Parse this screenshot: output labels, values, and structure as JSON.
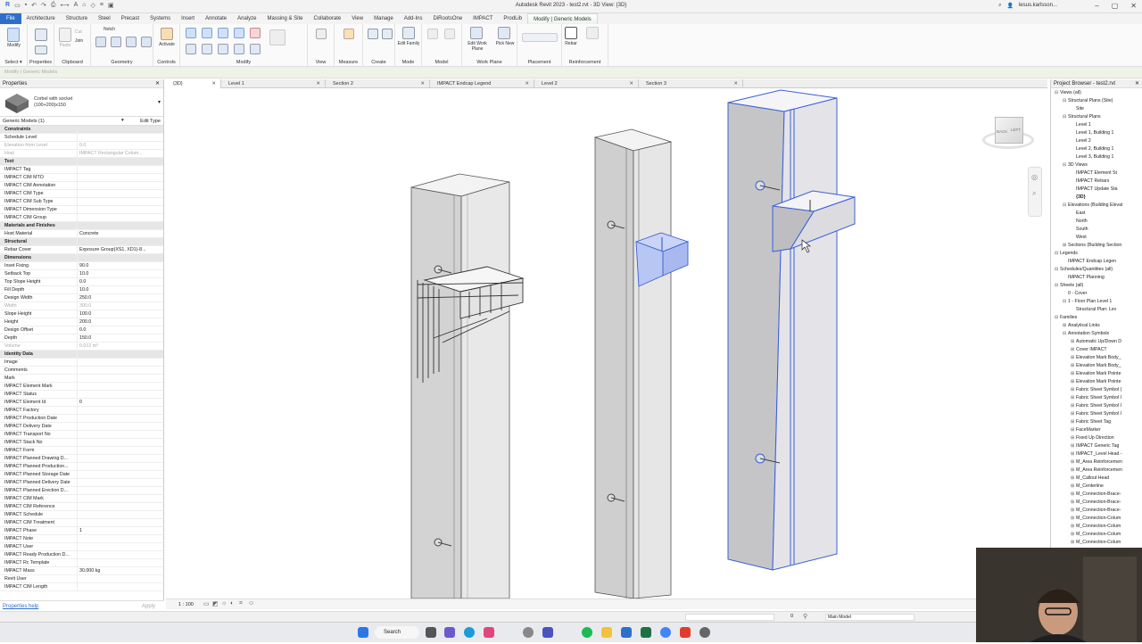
{
  "window": {
    "title": "Autodesk Revit 2023 - test2.rvt - 3D View: {3D}",
    "user": "lesus.karlsson..."
  },
  "tabs": [
    "File",
    "Architecture",
    "Structure",
    "Steel",
    "Precast",
    "Systems",
    "Insert",
    "Annotate",
    "Analyze",
    "Massing & Site",
    "Collaborate",
    "View",
    "Manage",
    "Add-Ins",
    "DiRootsOne",
    "IMPACT",
    "ProdLib",
    "Modify | Generic Models"
  ],
  "ribbon": {
    "groups": [
      "Select",
      "Properties",
      "Clipboard",
      "Geometry",
      "Modify",
      "View",
      "Measure",
      "Create",
      "Mode",
      "Model",
      "Work Plane",
      "Placement",
      "Reinforcement"
    ],
    "select_dropdown": "Select ▾",
    "buttons": {
      "modify": "Modify",
      "paste": "Paste",
      "cut": "Cut",
      "join": "Join",
      "notch": "Notch",
      "activate": "Activate",
      "edit_family": "Edit Family",
      "rebar": "Rebar",
      "edit_work_plane": "Edit Work Plane",
      "pick_new": "Pick New"
    }
  },
  "optionsbar": {
    "text": "Modify | Generic Models"
  },
  "properties": {
    "title": "Properties",
    "type_name": "Corbel with socket (100+200)x150",
    "selector": "Generic Models (1)",
    "edit_type": "Edit Type",
    "rows": [
      {
        "k": "Constraints",
        "v": "",
        "cat": true
      },
      {
        "k": "Schedule Level",
        "v": ""
      },
      {
        "k": "Elevation from Level",
        "v": "0.0",
        "dim": true
      },
      {
        "k": "Host",
        "v": "IMPACT Rectangular Colum...",
        "dim": true
      },
      {
        "k": "Text",
        "v": "",
        "cat": true
      },
      {
        "k": "IMPACT Tag",
        "v": ""
      },
      {
        "k": "IMPACT CIM MTO",
        "v": ""
      },
      {
        "k": "IMPACT CIM Annotation",
        "v": ""
      },
      {
        "k": "IMPACT CIM Type",
        "v": ""
      },
      {
        "k": "IMPACT CIM Sub Type",
        "v": ""
      },
      {
        "k": "IMPACT Dimension Type",
        "v": ""
      },
      {
        "k": "IMPACT CIM Group",
        "v": ""
      },
      {
        "k": "Materials and Finishes",
        "v": "",
        "cat": true
      },
      {
        "k": "Host Material",
        "v": "Concrete"
      },
      {
        "k": "Structural",
        "v": "",
        "cat": true
      },
      {
        "k": "Rebar Cover",
        "v": "Exposure Group(XS1, XD1)-8..."
      },
      {
        "k": "Dimensions",
        "v": "",
        "cat": true
      },
      {
        "k": "Inset Fixing",
        "v": "90.0"
      },
      {
        "k": "Setback Top",
        "v": "10.0"
      },
      {
        "k": "Top Slope Height",
        "v": "0.0"
      },
      {
        "k": "Fill Depth",
        "v": "10.0"
      },
      {
        "k": "Design Width",
        "v": "250.0"
      },
      {
        "k": "Width",
        "v": "300.0",
        "dim": true
      },
      {
        "k": "Slope Height",
        "v": "100.0"
      },
      {
        "k": "Height",
        "v": "200.0"
      },
      {
        "k": "Design Offset",
        "v": "0.0"
      },
      {
        "k": "Depth",
        "v": "150.0"
      },
      {
        "k": "Volume",
        "v": "0.012 m³",
        "dim": true
      },
      {
        "k": "Identity Data",
        "v": "",
        "cat": true
      },
      {
        "k": "Image",
        "v": ""
      },
      {
        "k": "Comments",
        "v": ""
      },
      {
        "k": "Mark",
        "v": ""
      },
      {
        "k": "IMPACT Element Mark",
        "v": ""
      },
      {
        "k": "IMPACT Status",
        "v": ""
      },
      {
        "k": "IMPACT Element Id",
        "v": "0"
      },
      {
        "k": "IMPACT Factory",
        "v": ""
      },
      {
        "k": "IMPACT Production Date",
        "v": ""
      },
      {
        "k": "IMPACT Delivery Date",
        "v": ""
      },
      {
        "k": "IMPACT Transport No",
        "v": ""
      },
      {
        "k": "IMPACT Stack No",
        "v": ""
      },
      {
        "k": "IMPACT Form",
        "v": ""
      },
      {
        "k": "IMPACT Planned Drawing D...",
        "v": ""
      },
      {
        "k": "IMPACT Planned Production...",
        "v": ""
      },
      {
        "k": "IMPACT Planned Storage Date",
        "v": ""
      },
      {
        "k": "IMPACT Planned Delivery Date",
        "v": ""
      },
      {
        "k": "IMPACT Planned Erection D...",
        "v": ""
      },
      {
        "k": "IMPACT CIM Mark",
        "v": ""
      },
      {
        "k": "IMPACT CIM Reference",
        "v": ""
      },
      {
        "k": "IMPACT Schedule",
        "v": ""
      },
      {
        "k": "IMPACT CIM Treatment",
        "v": ""
      },
      {
        "k": "IMPACT Phase",
        "v": "1"
      },
      {
        "k": "IMPACT Note",
        "v": ""
      },
      {
        "k": "IMPACT User",
        "v": ""
      },
      {
        "k": "IMPACT Ready Production D...",
        "v": ""
      },
      {
        "k": "IMPACT Rc Template",
        "v": ""
      },
      {
        "k": "IMPACT Mass",
        "v": "30.000 kg"
      },
      {
        "k": "Revit User",
        "v": ""
      },
      {
        "k": "IMPACT CIM Length",
        "v": ""
      }
    ],
    "help": "Properties help",
    "apply": "Apply"
  },
  "view_tabs": [
    {
      "label": "{3D}",
      "active": true
    },
    {
      "label": "Level 1"
    },
    {
      "label": "Section 2"
    },
    {
      "label": "IMPACT Endcap Legend"
    },
    {
      "label": "Level 2"
    },
    {
      "label": "Section 3"
    }
  ],
  "viewcube": {
    "faces": [
      "BACK",
      "LEFT"
    ]
  },
  "viewbar": {
    "scale": "1 : 100"
  },
  "statusbar": {
    "model": "Main Model",
    "filter": "0"
  },
  "project_browser": {
    "title": "Project Browser - test2.rvt",
    "items": [
      {
        "t": "Views (all)",
        "d": 0,
        "tg": "⊟"
      },
      {
        "t": "Structural Plans (Site)",
        "d": 1,
        "tg": "⊟"
      },
      {
        "t": "Site",
        "d": 2,
        "tg": ""
      },
      {
        "t": "Structural Plans",
        "d": 1,
        "tg": "⊟"
      },
      {
        "t": "Level 1",
        "d": 2,
        "tg": ""
      },
      {
        "t": "Level 1, Building 1",
        "d": 2,
        "tg": ""
      },
      {
        "t": "Level 2",
        "d": 2,
        "tg": ""
      },
      {
        "t": "Level 2, Building 1",
        "d": 2,
        "tg": ""
      },
      {
        "t": "Level 3, Building 1",
        "d": 2,
        "tg": ""
      },
      {
        "t": "3D Views",
        "d": 1,
        "tg": "⊟"
      },
      {
        "t": "IMPACT Element St",
        "d": 2,
        "tg": ""
      },
      {
        "t": "IMPACT Rebars",
        "d": 2,
        "tg": ""
      },
      {
        "t": "IMPACT Update Sta",
        "d": 2,
        "tg": ""
      },
      {
        "t": "{3D}",
        "d": 2,
        "tg": "",
        "bold": true
      },
      {
        "t": "Elevations (Building Eleval",
        "d": 1,
        "tg": "⊟"
      },
      {
        "t": "East",
        "d": 2,
        "tg": ""
      },
      {
        "t": "North",
        "d": 2,
        "tg": ""
      },
      {
        "t": "South",
        "d": 2,
        "tg": ""
      },
      {
        "t": "West",
        "d": 2,
        "tg": ""
      },
      {
        "t": "Sections (Building Section",
        "d": 1,
        "tg": "⊞"
      },
      {
        "t": "Legends",
        "d": 0,
        "tg": "⊟"
      },
      {
        "t": "IMPACT Endcap Legen",
        "d": 1,
        "tg": ""
      },
      {
        "t": "Schedules/Quantities (all)",
        "d": 0,
        "tg": "⊟"
      },
      {
        "t": "IMPACT Planning",
        "d": 1,
        "tg": ""
      },
      {
        "t": "Sheets (all)",
        "d": 0,
        "tg": "⊟"
      },
      {
        "t": "0 - Cover",
        "d": 1,
        "tg": ""
      },
      {
        "t": "1 - Floor Plan Level 1",
        "d": 1,
        "tg": "⊟"
      },
      {
        "t": "Structural Plan: Lev",
        "d": 2,
        "tg": ""
      },
      {
        "t": "Families",
        "d": 0,
        "tg": "⊟"
      },
      {
        "t": "Analytical Links",
        "d": 1,
        "tg": "⊞"
      },
      {
        "t": "Annotation Symbols",
        "d": 1,
        "tg": "⊟"
      },
      {
        "t": "Automatic Up/Down D",
        "d": 2,
        "tg": "⊞"
      },
      {
        "t": "Cover IMPACT",
        "d": 2,
        "tg": "⊞"
      },
      {
        "t": "Elevation Mark Body_",
        "d": 2,
        "tg": "⊞"
      },
      {
        "t": "Elevation Mark Body_",
        "d": 2,
        "tg": "⊞"
      },
      {
        "t": "Elevation Mark Pointe",
        "d": 2,
        "tg": "⊞"
      },
      {
        "t": "Elevation Mark Pointe",
        "d": 2,
        "tg": "⊞"
      },
      {
        "t": "Fabric Sheet Symbol (",
        "d": 2,
        "tg": "⊞"
      },
      {
        "t": "Fabric Sheet Symbol I",
        "d": 2,
        "tg": "⊞"
      },
      {
        "t": "Fabric Sheet Symbol I",
        "d": 2,
        "tg": "⊞"
      },
      {
        "t": "Fabric Sheet Symbol I",
        "d": 2,
        "tg": "⊞"
      },
      {
        "t": "Fabric Sheet Tag",
        "d": 2,
        "tg": "⊞"
      },
      {
        "t": "FaceMarker",
        "d": 2,
        "tg": "⊞"
      },
      {
        "t": "Fixed Up Direction",
        "d": 2,
        "tg": "⊞"
      },
      {
        "t": "IMPACT Generic Tag",
        "d": 2,
        "tg": "⊞"
      },
      {
        "t": "IMPACT_Level Head -",
        "d": 2,
        "tg": "⊞"
      },
      {
        "t": "M_Area Reinforcemen",
        "d": 2,
        "tg": "⊞"
      },
      {
        "t": "M_Area Reinforcemen",
        "d": 2,
        "tg": "⊞"
      },
      {
        "t": "M_Callout Head",
        "d": 2,
        "tg": "⊞"
      },
      {
        "t": "M_Centerline",
        "d": 2,
        "tg": "⊞"
      },
      {
        "t": "M_Connection-Brace-",
        "d": 2,
        "tg": "⊞"
      },
      {
        "t": "M_Connection-Brace-",
        "d": 2,
        "tg": "⊞"
      },
      {
        "t": "M_Connection-Brace-",
        "d": 2,
        "tg": "⊞"
      },
      {
        "t": "M_Connection-Colum",
        "d": 2,
        "tg": "⊞"
      },
      {
        "t": "M_Connection-Colum",
        "d": 2,
        "tg": "⊞"
      },
      {
        "t": "M_Connection-Colum",
        "d": 2,
        "tg": "⊞"
      },
      {
        "t": "M_Connection-Colum",
        "d": 2,
        "tg": "⊞"
      }
    ]
  },
  "taskbar": {
    "search": "Search"
  },
  "colors": {
    "file_tab": "#2f6fc9",
    "selection": "#3b5fd6",
    "accent_green": "#eaf2ea"
  }
}
